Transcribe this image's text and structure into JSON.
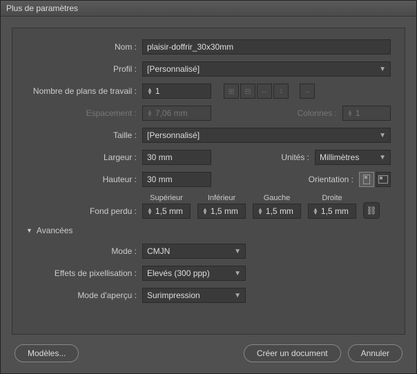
{
  "title": "Plus de paramètres",
  "fields": {
    "name_label": "Nom :",
    "name_value": "plaisir-doffrir_30x30mm",
    "profile_label": "Profil :",
    "profile_value": "[Personnalisé]",
    "artboards_label": "Nombre de plans de travail :",
    "artboards_value": "1",
    "spacing_label": "Espacement :",
    "spacing_value": "7,06 mm",
    "columns_label": "Colonnes :",
    "columns_value": "1",
    "size_label": "Taille :",
    "size_value": "[Personnalisé]",
    "width_label": "Largeur :",
    "width_value": "30 mm",
    "units_label": "Unités :",
    "units_value": "Millimètres",
    "height_label": "Hauteur :",
    "height_value": "30 mm",
    "orientation_label": "Orientation :",
    "bleed_label": "Fond perdu :",
    "bleed_top_label": "Supérieur",
    "bleed_bottom_label": "Inférieur",
    "bleed_left_label": "Gauche",
    "bleed_right_label": "Droite",
    "bleed_top": "1,5 mm",
    "bleed_bottom": "1,5 mm",
    "bleed_left": "1,5 mm",
    "bleed_right": "1,5 mm",
    "advanced_label": "Avancées",
    "mode_label": "Mode :",
    "mode_value": "CMJN",
    "raster_label": "Effets de pixellisation :",
    "raster_value": "Elevés (300 ppp)",
    "preview_label": "Mode d'aperçu :",
    "preview_value": "Surimpression"
  },
  "buttons": {
    "templates": "Modèles...",
    "create": "Créer un document",
    "cancel": "Annuler"
  }
}
